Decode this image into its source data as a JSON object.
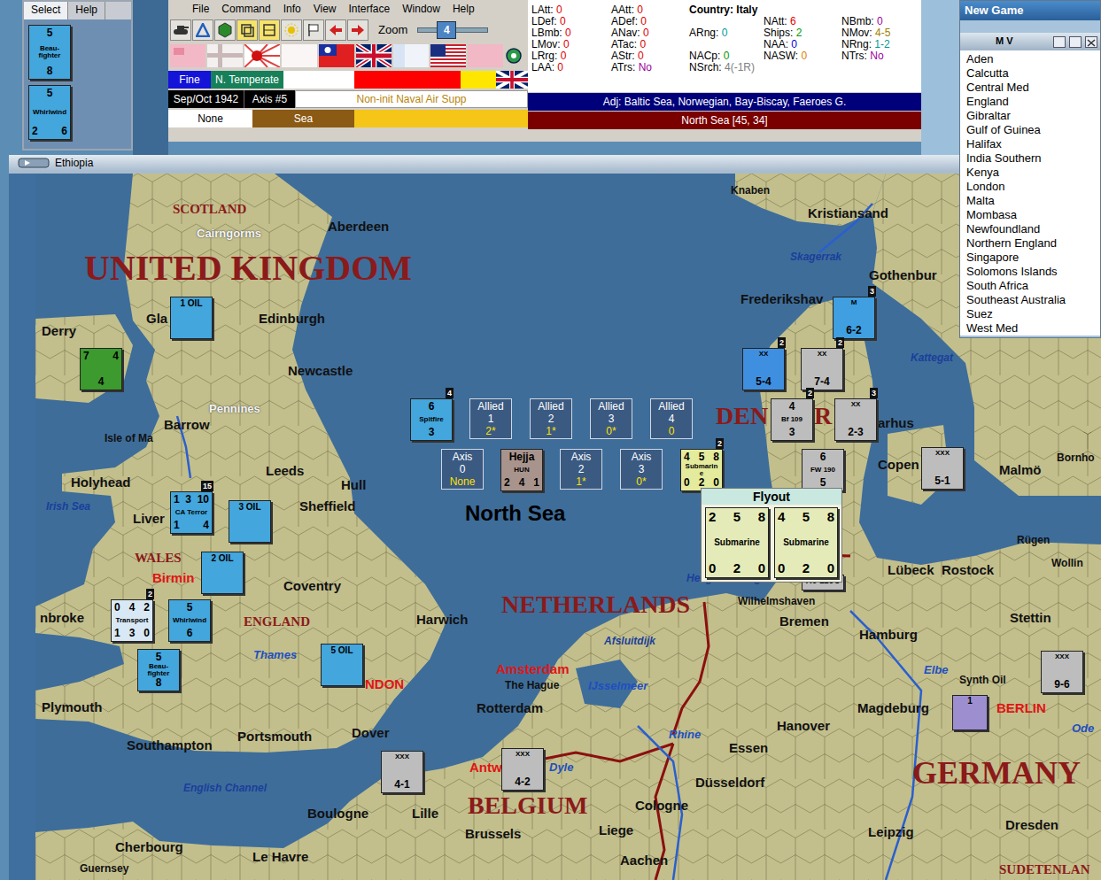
{
  "left_window": {
    "tabs": [
      {
        "label": "Select",
        "selected": true
      },
      {
        "label": "Help",
        "selected": false
      }
    ],
    "counters": [
      {
        "lines": [
          [
            "5"
          ],
          [
            "Beau-fighter"
          ],
          [
            "8"
          ]
        ],
        "color": "#43a6dc"
      },
      {
        "lines": [
          [
            "5"
          ],
          [
            "Whirlwind"
          ],
          [
            "2",
            "6"
          ]
        ],
        "color": "#43a6dc"
      }
    ]
  },
  "menu": [
    "File",
    "Command",
    "Info",
    "View",
    "Interface",
    "Window",
    "Help"
  ],
  "zoom": {
    "label": "Zoom",
    "value": "4",
    "level": 0.38
  },
  "status_rows": [
    [
      {
        "text": "Fine",
        "color": "#1414d8"
      },
      {
        "text": "N. Temperate",
        "color": "#17805a"
      }
    ],
    [
      {
        "text": "Sep/Oct 1942",
        "color": "#000000"
      },
      {
        "text": "Axis #5",
        "color": "#000000"
      },
      {
        "text": "Non-init Naval Air Supp",
        "color": "#ffffff"
      }
    ],
    [
      {
        "text": "None",
        "color": "#ffffff"
      },
      {
        "text": "Sea",
        "color": "#8b5a14"
      }
    ]
  ],
  "stats": {
    "items": [
      {
        "label": "LAtt: ",
        "value": "0",
        "color": "#e00000"
      },
      {
        "label": "LDef: ",
        "value": "0",
        "color": "#e00000"
      },
      {
        "label": "LBmb: ",
        "value": "0",
        "color": "#e00000"
      },
      {
        "label": "LMov: ",
        "value": "0",
        "color": "#e00000"
      },
      {
        "label": "LRrg: ",
        "value": "0",
        "color": "#e00000"
      },
      {
        "label": "LAA: ",
        "value": "0",
        "color": "#e00000"
      },
      {
        "label": "AAtt: ",
        "value": "0",
        "color": "#e00000"
      },
      {
        "label": "ADef: ",
        "value": "0",
        "color": "#e00000"
      },
      {
        "label": "ANav: ",
        "value": "0",
        "color": "#e00000"
      },
      {
        "label": "ATac: ",
        "value": "0",
        "color": "#e00000"
      },
      {
        "label": "AStr: ",
        "value": "0",
        "color": "#e00000"
      },
      {
        "label": "ATrs: ",
        "value": "No",
        "color": "#a000a0"
      },
      {
        "label": "Country: ",
        "value": "Italy",
        "color": "#000000"
      },
      {
        "label": "ARng: ",
        "value": "0",
        "color": "#009a9a"
      },
      {
        "label": "NACp: ",
        "value": "0",
        "color": "#009a00"
      },
      {
        "label": "NSrch: ",
        "value": "4(-1R)",
        "color": "#808080"
      },
      {
        "label": "NAtt: ",
        "value": "6",
        "color": "#e00000"
      },
      {
        "label": "Ships: ",
        "value": "2",
        "color": "#009a00"
      },
      {
        "label": "NAA: ",
        "value": "0",
        "color": "#0000e0"
      },
      {
        "label": "NASW: ",
        "value": "0",
        "color": "#e08000"
      },
      {
        "label": "NBmb: ",
        "value": "0",
        "color": "#a000a0"
      },
      {
        "label": "NMov: ",
        "value": "4-5",
        "color": "#a08000"
      },
      {
        "label": "NRng: ",
        "value": "1-2",
        "color": "#009a9a"
      },
      {
        "label": "NTrs: ",
        "value": "No",
        "color": "#a000a0"
      }
    ],
    "adjacent": "Adj: Baltic Sea, Norwegian, Bay-Biscay, Faeroes G.",
    "hex": "North Sea [45, 34]"
  },
  "new_game": {
    "title": "New Game",
    "list_title": "M V",
    "items": [
      "Aden",
      "Calcutta",
      "Central Med",
      "England",
      "Gibraltar",
      "Gulf of Guinea",
      "Halifax",
      "India Southern",
      "Kenya",
      "London",
      "Malta",
      "Mombasa",
      "Newfoundland",
      "Northern England",
      "Singapore",
      "Solomons Islands",
      "South Africa",
      "Southeast Australia",
      "Suez",
      "West Med"
    ]
  },
  "map": {
    "title": "Ethiopia",
    "labels": [
      {
        "text": "SCOTLAND",
        "kind": "region"
      },
      {
        "text": "Cairngorms",
        "kind": "terrain"
      },
      {
        "text": "Aberdeen",
        "kind": "city"
      },
      {
        "text": "UNITED KINGDOM",
        "kind": "nationxl"
      },
      {
        "text": "Gla",
        "kind": "city"
      },
      {
        "text": "Edinburgh",
        "kind": "city"
      },
      {
        "text": "Derry",
        "kind": "city"
      },
      {
        "text": "Newcastle",
        "kind": "city"
      },
      {
        "text": "Pennines",
        "kind": "terrain"
      },
      {
        "text": "Barrow",
        "kind": "city"
      },
      {
        "text": "Isle of Ma",
        "kind": "minor"
      },
      {
        "text": "Leeds",
        "kind": "city"
      },
      {
        "text": "Hull",
        "kind": "city"
      },
      {
        "text": "Holyhead",
        "kind": "city"
      },
      {
        "text": "Irish Sea",
        "kind": "water"
      },
      {
        "text": "Liver",
        "kind": "city"
      },
      {
        "text": "Sheffield",
        "kind": "city"
      },
      {
        "text": "WALES",
        "kind": "region"
      },
      {
        "text": "Birmin",
        "kind": "capital"
      },
      {
        "text": "Coventry",
        "kind": "city"
      },
      {
        "text": "ENGLAND",
        "kind": "region"
      },
      {
        "text": "Harwich",
        "kind": "city"
      },
      {
        "text": "nbroke",
        "kind": "city"
      },
      {
        "text": "Thames",
        "kind": "river"
      },
      {
        "text": "NDON",
        "kind": "capital"
      },
      {
        "text": "Plymouth",
        "kind": "city"
      },
      {
        "text": "Southampton",
        "kind": "city"
      },
      {
        "text": "Portsmouth",
        "kind": "city"
      },
      {
        "text": "Dover",
        "kind": "city"
      },
      {
        "text": "English Channel",
        "kind": "water"
      },
      {
        "text": "Boulogne",
        "kind": "city"
      },
      {
        "text": "Lille",
        "kind": "city"
      },
      {
        "text": "Cherbourg",
        "kind": "city"
      },
      {
        "text": "Le Havre",
        "kind": "city"
      },
      {
        "text": "Guernsey",
        "kind": "minor"
      },
      {
        "text": "NETHERLANDS",
        "kind": "nation"
      },
      {
        "text": "Afsluitdijk",
        "kind": "water"
      },
      {
        "text": "Amsterdam",
        "kind": "capital"
      },
      {
        "text": "The Hague",
        "kind": "minor"
      },
      {
        "text": "IJsselmeer",
        "kind": "river"
      },
      {
        "text": "Rotterdam",
        "kind": "city"
      },
      {
        "text": "Antw",
        "kind": "capital"
      },
      {
        "text": "Dyle",
        "kind": "river"
      },
      {
        "text": "BELGIUM",
        "kind": "nation"
      },
      {
        "text": "Brussels",
        "kind": "city"
      },
      {
        "text": "Liege",
        "kind": "city"
      },
      {
        "text": "Aachen",
        "kind": "city"
      },
      {
        "text": "Cologne",
        "kind": "city"
      },
      {
        "text": "Düsseldorf",
        "kind": "city"
      },
      {
        "text": "Essen",
        "kind": "city"
      },
      {
        "text": "Rhine",
        "kind": "river"
      },
      {
        "text": "Heligoland Bight",
        "kind": "water"
      },
      {
        "text": "Wilhelmshaven",
        "kind": "minor"
      },
      {
        "text": "Bremen",
        "kind": "city"
      },
      {
        "text": "Hamburg",
        "kind": "city"
      },
      {
        "text": "Hanover",
        "kind": "city"
      },
      {
        "text": "Elbe",
        "kind": "river"
      },
      {
        "text": "Magdeburg",
        "kind": "city"
      },
      {
        "text": "Synth Oil",
        "kind": "minor"
      },
      {
        "text": "BERLIN",
        "kind": "capital"
      },
      {
        "text": "Ode",
        "kind": "river"
      },
      {
        "text": "GERMANY",
        "kind": "nationlg"
      },
      {
        "text": "Leipzig",
        "kind": "city"
      },
      {
        "text": "Dresden",
        "kind": "city"
      },
      {
        "text": "SUDETENLAN",
        "kind": "region"
      },
      {
        "text": "Lübeck",
        "kind": "city"
      },
      {
        "text": "Rostock",
        "kind": "city"
      },
      {
        "text": "Rügen",
        "kind": "minor"
      },
      {
        "text": "Wollin",
        "kind": "minor"
      },
      {
        "text": "Stettin",
        "kind": "city"
      },
      {
        "text": "Malmö",
        "kind": "city"
      },
      {
        "text": "Bornho",
        "kind": "minor"
      },
      {
        "text": "Copen",
        "kind": "city"
      },
      {
        "text": "arhus",
        "kind": "city"
      },
      {
        "text": "DEN",
        "kind": "nation"
      },
      {
        "text": "R",
        "kind": "nation"
      },
      {
        "text": "Kattegat",
        "kind": "water"
      },
      {
        "text": "Gothenbur",
        "kind": "city"
      },
      {
        "text": "Frederikshav",
        "kind": "city"
      },
      {
        "text": "Skagerrak",
        "kind": "water"
      },
      {
        "text": "Kristiansand",
        "kind": "city"
      },
      {
        "text": "Knaben",
        "kind": "minor"
      },
      {
        "text": "North Sea",
        "kind": "sea"
      }
    ],
    "units": [
      {
        "lines": [
          [
            "1 OIL"
          ]
        ],
        "color": "#43a6dc"
      },
      {
        "lines": [
          [
            "7",
            "4"
          ],
          [
            "4"
          ]
        ],
        "color": "#3c9a2e"
      },
      {
        "lines": [
          [
            "1",
            "3",
            "10"
          ],
          [
            "CA Terror"
          ],
          [
            "1",
            "4"
          ]
        ],
        "color": "#43a6dc",
        "stack": "15"
      },
      {
        "lines": [
          [
            "3 OIL"
          ]
        ],
        "color": "#43a6dc"
      },
      {
        "lines": [
          [
            "2 OIL"
          ]
        ],
        "color": "#43a6dc"
      },
      {
        "lines": [
          [
            "0",
            "4",
            "2"
          ],
          [
            "Transport"
          ],
          [
            "1",
            "3",
            "0"
          ]
        ],
        "color": "#d8e8f4",
        "stack": "2"
      },
      {
        "lines": [
          [
            "5"
          ],
          [
            "Whirlwind"
          ],
          [
            "6"
          ]
        ],
        "color": "#43a6dc"
      },
      {
        "lines": [
          [
            "5"
          ],
          [
            "Beau-fighter"
          ],
          [
            "8"
          ]
        ],
        "color": "#43a6dc"
      },
      {
        "lines": [
          [
            "5 OIL"
          ]
        ],
        "color": "#43a6dc"
      },
      {
        "lines": [
          [
            "6"
          ],
          [
            "Spitfire"
          ],
          [
            "3"
          ]
        ],
        "color": "#43a6dc",
        "stack": "4"
      },
      {
        "lines": [
          [
            "Hejja"
          ],
          [
            "HUN"
          ],
          [
            "2",
            "4",
            "1"
          ]
        ],
        "color": "#a8948c"
      },
      {
        "lines": [
          [
            "4",
            "5",
            "8"
          ],
          [
            "Submarine"
          ],
          [
            "0",
            "2",
            "0"
          ]
        ],
        "color": "#e4eb9c",
        "stack": "2"
      },
      {
        "lines": [
          [
            "M"
          ],
          [
            "6-2"
          ]
        ],
        "color": "#3f9fe0",
        "stack": "3"
      },
      {
        "lines": [
          [
            "XX"
          ],
          [
            "5-4"
          ]
        ],
        "color": "#3f8fe0",
        "stack": "2"
      },
      {
        "lines": [
          [
            "XX"
          ],
          [
            "7-4"
          ]
        ],
        "color": "#bdbdbd",
        "stack": "2"
      },
      {
        "lines": [
          [
            "4"
          ],
          [
            "Bf 109"
          ],
          [
            "3"
          ]
        ],
        "color": "#bdbdbd",
        "stack": "2"
      },
      {
        "lines": [
          [
            "XX"
          ],
          [
            "2-3"
          ]
        ],
        "color": "#bdbdbd",
        "stack": "3"
      },
      {
        "lines": [
          [
            "6"
          ],
          [
            "FW 190"
          ],
          [
            "5"
          ]
        ],
        "color": "#bdbdbd"
      },
      {
        "lines": [
          [
            "XXX"
          ],
          [
            "5-1"
          ]
        ],
        "color": "#bdbdbd"
      },
      {
        "lines": [
          [
            "He 115C"
          ]
        ],
        "color": "#bdbdbd"
      },
      {
        "lines": [
          [
            "XXX"
          ],
          [
            "4-1"
          ]
        ],
        "color": "#bdbdbd"
      },
      {
        "lines": [
          [
            "XXX"
          ],
          [
            "4-2"
          ]
        ],
        "color": "#bdbdbd"
      },
      {
        "lines": [
          [
            "XXX"
          ],
          [
            "9-6"
          ]
        ],
        "color": "#bdbdbd"
      },
      {
        "lines": [
          [
            "1"
          ]
        ],
        "color": "#9d8fcf"
      }
    ],
    "battle_boxes": [
      {
        "side": "Allied",
        "number": "1",
        "value": "2*"
      },
      {
        "side": "Allied",
        "number": "2",
        "value": "1*"
      },
      {
        "side": "Allied",
        "number": "3",
        "value": "0*"
      },
      {
        "side": "Allied",
        "number": "4",
        "value": "0"
      },
      {
        "side": "Axis",
        "number": "0",
        "value": "None"
      },
      {
        "side": "Axis",
        "number": "2",
        "value": "1*"
      },
      {
        "side": "Axis",
        "number": "3",
        "value": "0*"
      }
    ],
    "flyout": {
      "title": "Flyout",
      "units": [
        {
          "lines": [
            [
              "2",
              "5",
              "8"
            ],
            [
              "Submarine"
            ],
            [
              "0",
              "2",
              "0"
            ]
          ],
          "color": "#e4ebb8"
        },
        {
          "lines": [
            [
              "4",
              "5",
              "8"
            ],
            [
              "Submarine"
            ],
            [
              "0",
              "2",
              "0"
            ]
          ],
          "color": "#e4ebb8"
        }
      ]
    }
  }
}
